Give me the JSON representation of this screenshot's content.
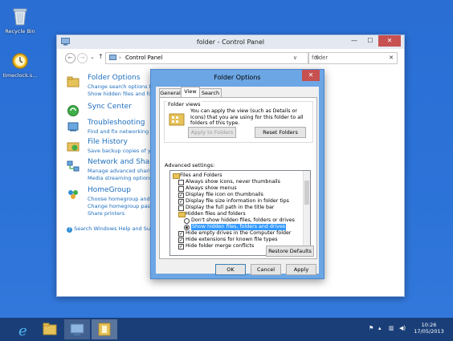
{
  "desktop": {
    "icons": [
      {
        "label": "Recycle Bin",
        "icon": "recycle-bin-icon"
      },
      {
        "label": "timeclock.s...",
        "icon": "timeclock-icon"
      }
    ]
  },
  "window": {
    "title": "folder - Control Panel",
    "buttons": {
      "minimize": "—",
      "maximize": "☐",
      "close": "✕"
    }
  },
  "address": {
    "back": "←",
    "forward": "→",
    "up": "↑",
    "breadcrumb_sep": "›",
    "location": "Control Panel",
    "dropdown": "∨",
    "refresh": "↻",
    "search_value": "folder",
    "search_clear": "✕"
  },
  "categories": [
    {
      "title": "Folder Options",
      "icon": "folder-options-icon",
      "links": [
        "Change search options for files and folders",
        "Show hidden files and folders"
      ]
    },
    {
      "title": "Sync Center",
      "icon": "sync-center-icon",
      "links": []
    },
    {
      "title": "Troubleshooting",
      "icon": "troubleshooting-icon",
      "links": [
        "Find and fix networking and connection problems"
      ]
    },
    {
      "title": "File History",
      "icon": "file-history-icon",
      "links": [
        "Save backup copies of your files with File History"
      ]
    },
    {
      "title": "Network and Sharing Center",
      "icon": "network-sharing-icon",
      "links": [
        "Manage advanced sharing settings",
        "Media streaming options"
      ]
    },
    {
      "title": "HomeGroup",
      "icon": "homegroup-icon",
      "links": [
        "Choose homegroup and sharing options",
        "Change homegroup password",
        "Share printers"
      ]
    }
  ],
  "help_link": "Search Windows Help and Support for \"folder\"",
  "dialog": {
    "title": "Folder Options",
    "close": "✕",
    "tabs": [
      "General",
      "View",
      "Search"
    ],
    "active_tab": "View",
    "folder_views": {
      "label": "Folder views",
      "description": "You can apply the view (such as Details or Icons) that you are using for this folder to all folders of this type.",
      "apply_button": "Apply to Folders",
      "reset_button": "Reset Folders"
    },
    "advanced_label": "Advanced settings:",
    "settings": [
      {
        "kind": "folder",
        "level": 0,
        "text": "Files and Folders"
      },
      {
        "kind": "check",
        "level": 1,
        "checked": false,
        "text": "Always show icons, never thumbnails"
      },
      {
        "kind": "check",
        "level": 1,
        "checked": false,
        "text": "Always show menus"
      },
      {
        "kind": "check",
        "level": 1,
        "checked": true,
        "text": "Display file icon on thumbnails"
      },
      {
        "kind": "check",
        "level": 1,
        "checked": true,
        "text": "Display file size information in folder tips"
      },
      {
        "kind": "check",
        "level": 1,
        "checked": false,
        "text": "Display the full path in the title bar"
      },
      {
        "kind": "folder",
        "level": 1,
        "text": "Hidden files and folders"
      },
      {
        "kind": "radio",
        "level": 2,
        "checked": false,
        "text": "Don't show hidden files, folders or drives"
      },
      {
        "kind": "radio",
        "level": 2,
        "checked": true,
        "selected": true,
        "text": "Show hidden files, folders and drives"
      },
      {
        "kind": "check",
        "level": 1,
        "checked": true,
        "text": "Hide empty drives in the Computer folder"
      },
      {
        "kind": "check",
        "level": 1,
        "checked": true,
        "text": "Hide extensions for known file types"
      },
      {
        "kind": "check",
        "level": 1,
        "checked": true,
        "text": "Hide folder merge conflicts"
      }
    ],
    "restore_button": "Restore Defaults",
    "ok_button": "OK",
    "cancel_button": "Cancel",
    "apply_button": "Apply"
  },
  "taskbar": {
    "apps": [
      {
        "icon": "internet-explorer-icon"
      },
      {
        "icon": "file-explorer-icon"
      },
      {
        "icon": "control-panel-icon"
      },
      {
        "icon": "folder-icon"
      }
    ],
    "tray_icons": [
      "flag-icon",
      "network-icon",
      "volume-icon"
    ],
    "time": "10:26",
    "date": "17/05/2013"
  }
}
